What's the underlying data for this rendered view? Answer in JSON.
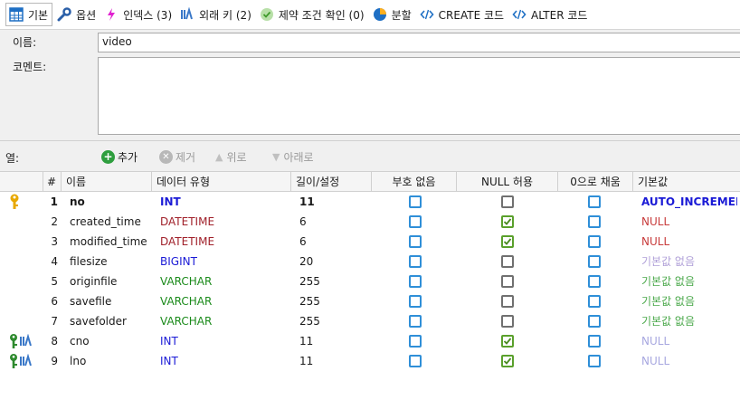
{
  "tabs": [
    {
      "label": "기본",
      "icon": "table-icon",
      "active": true
    },
    {
      "label": "옵션",
      "icon": "wrench-icon"
    },
    {
      "label": "인덱스 (3)",
      "icon": "lightning-icon"
    },
    {
      "label": "외래 키 (2)",
      "icon": "foreign-key-icon"
    },
    {
      "label": "제약 조건 확인 (0)",
      "icon": "check-circle-icon"
    },
    {
      "label": "분할",
      "icon": "partition-icon"
    },
    {
      "label": "CREATE 코드",
      "icon": "code-icon"
    },
    {
      "label": "ALTER 코드",
      "icon": "code-icon"
    }
  ],
  "form": {
    "name_label": "이름:",
    "name_value": "video",
    "comment_label": "코멘트:",
    "comment_value": ""
  },
  "columns_toolbar": {
    "label": "열:",
    "add": "추가",
    "remove": "제거",
    "up": "위로",
    "down": "아래로"
  },
  "headers": [
    "#",
    "이름",
    "데이터 유형",
    "길이/설정",
    "부호 없음",
    "NULL 허용",
    "0으로 채움",
    "기본값"
  ],
  "rows": [
    {
      "num": "1",
      "name": "no",
      "type": "INT",
      "length": "11",
      "unsigned": false,
      "allow_null": false,
      "zerofill": false,
      "default": "AUTO_INCREMENT",
      "primary": true,
      "foreign": false
    },
    {
      "num": "2",
      "name": "created_time",
      "type": "DATETIME",
      "length": "6",
      "unsigned": false,
      "allow_null": true,
      "zerofill": false,
      "default": "NULL",
      "primary": false,
      "foreign": false
    },
    {
      "num": "3",
      "name": "modified_time",
      "type": "DATETIME",
      "length": "6",
      "unsigned": false,
      "allow_null": true,
      "zerofill": false,
      "default": "NULL",
      "primary": false,
      "foreign": false
    },
    {
      "num": "4",
      "name": "filesize",
      "type": "BIGINT",
      "length": "20",
      "unsigned": false,
      "allow_null": false,
      "zerofill": false,
      "default": "기본값 없음",
      "primary": false,
      "foreign": false
    },
    {
      "num": "5",
      "name": "originfile",
      "type": "VARCHAR",
      "length": "255",
      "unsigned": false,
      "allow_null": false,
      "zerofill": false,
      "default": "기본값 없음",
      "primary": false,
      "foreign": false
    },
    {
      "num": "6",
      "name": "savefile",
      "type": "VARCHAR",
      "length": "255",
      "unsigned": false,
      "allow_null": false,
      "zerofill": false,
      "default": "기본값 없음",
      "primary": false,
      "foreign": false
    },
    {
      "num": "7",
      "name": "savefolder",
      "type": "VARCHAR",
      "length": "255",
      "unsigned": false,
      "allow_null": false,
      "zerofill": false,
      "default": "기본값 없음",
      "primary": false,
      "foreign": false
    },
    {
      "num": "8",
      "name": "cno",
      "type": "INT",
      "length": "11",
      "unsigned": false,
      "allow_null": true,
      "zerofill": false,
      "default": "NULL",
      "primary": false,
      "foreign": true
    },
    {
      "num": "9",
      "name": "lno",
      "type": "INT",
      "length": "11",
      "unsigned": false,
      "allow_null": true,
      "zerofill": false,
      "default": "NULL",
      "primary": false,
      "foreign": true
    }
  ],
  "colors": {
    "int": "#1a1ad6",
    "datetime": "#a0202a",
    "bigint": "#1a1ad6",
    "varchar": "#1a8a1a",
    "default_null_red": "#c83c3c",
    "default_none": "#b0a0d8",
    "default_none_green": "#4aa84a",
    "default_null_light": "#a8a8e0"
  }
}
